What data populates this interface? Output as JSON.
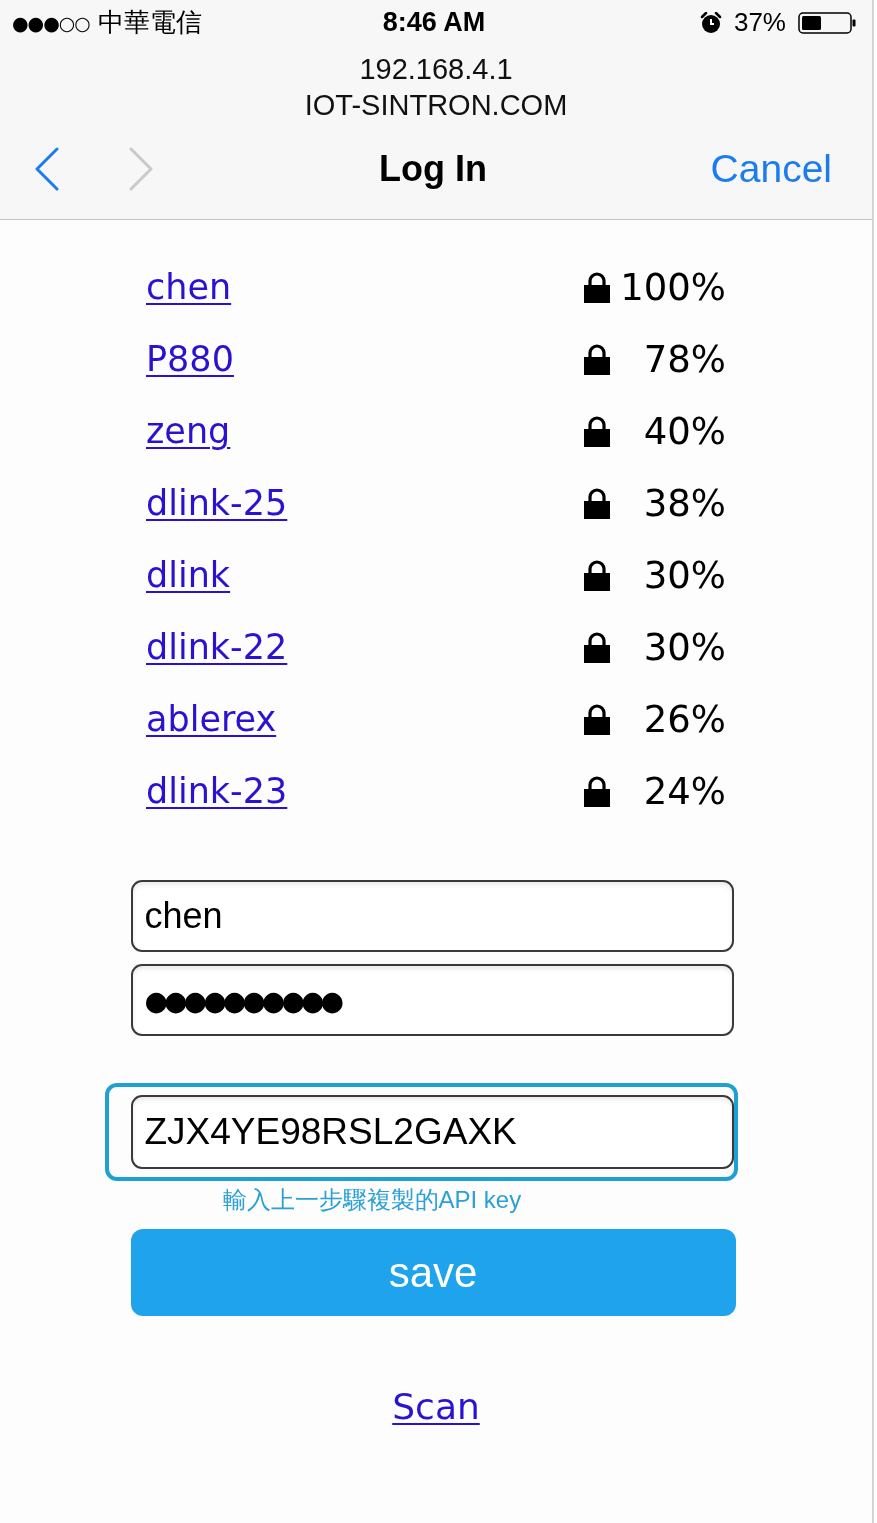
{
  "status_bar": {
    "signal": "●●●○○",
    "carrier": "中華電信",
    "time": "8:46 AM",
    "battery": "37%"
  },
  "address": {
    "host": "192.168.4.1",
    "site": "IOT-SINTRON.COM"
  },
  "nav": {
    "back": {
      "disabled": false
    },
    "forward": {
      "disabled": true
    },
    "title": "Log In",
    "cancel": "Cancel"
  },
  "networks": [
    {
      "ssid": "chen",
      "secured": true,
      "strength": "100%"
    },
    {
      "ssid": "P880",
      "secured": true,
      "strength": "78%"
    },
    {
      "ssid": "zeng",
      "secured": true,
      "strength": "40%"
    },
    {
      "ssid": "dlink-25",
      "secured": true,
      "strength": "38%"
    },
    {
      "ssid": "dlink",
      "secured": true,
      "strength": "30%"
    },
    {
      "ssid": "dlink-22",
      "secured": true,
      "strength": "30%"
    },
    {
      "ssid": "ablerex",
      "secured": true,
      "strength": "26%"
    },
    {
      "ssid": "dlink-23",
      "secured": true,
      "strength": "24%"
    }
  ],
  "form": {
    "ssid_field": {
      "value": "chen"
    },
    "password_field": {
      "value": "●●●●●●●●●●"
    },
    "api_key_field": {
      "value": "ZJX4YE98RSL2GAXK",
      "focused": true
    },
    "hint": "輸入上一步驟複製的API key",
    "save_button": "save"
  },
  "scan_link": "Scan"
}
